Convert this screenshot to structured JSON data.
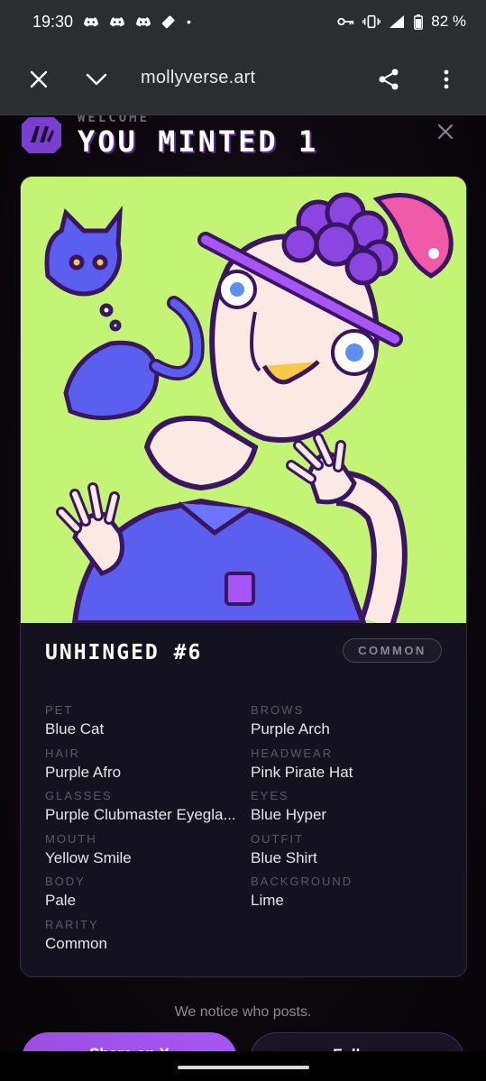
{
  "status_bar": {
    "time": "19:30",
    "notification_icons": [
      "discord-icon",
      "discord-icon",
      "discord-icon",
      "eraser-icon"
    ],
    "more_dot": "•",
    "battery": "82 %"
  },
  "browser": {
    "url": "mollyverse.art"
  },
  "modal": {
    "welcome": "WELCOME",
    "headline": "YOU MINTED 1"
  },
  "nft": {
    "name": "UNHINGED #6",
    "rarity_badge": "COMMON",
    "traits": [
      {
        "label": "PET",
        "value": "Blue Cat"
      },
      {
        "label": "BROWS",
        "value": "Purple Arch"
      },
      {
        "label": "HAIR",
        "value": "Purple Afro"
      },
      {
        "label": "HEADWEAR",
        "value": "Pink Pirate Hat"
      },
      {
        "label": "GLASSES",
        "value": "Purple Clubmaster Eyegla..."
      },
      {
        "label": "EYES",
        "value": "Blue Hyper"
      },
      {
        "label": "MOUTH",
        "value": "Yellow Smile"
      },
      {
        "label": "OUTFIT",
        "value": "Blue Shirt"
      },
      {
        "label": "BODY",
        "value": "Pale"
      },
      {
        "label": "BACKGROUND",
        "value": "Lime"
      },
      {
        "label": "RARITY",
        "value": "Common"
      }
    ]
  },
  "footer": {
    "note": "We notice who posts.",
    "share_label": "Share on X",
    "follow_label": "Follow"
  },
  "colors": {
    "art_background": "#c3f474",
    "accent_purple": "#a855f7",
    "toolbar_bg": "#2b2d30"
  }
}
